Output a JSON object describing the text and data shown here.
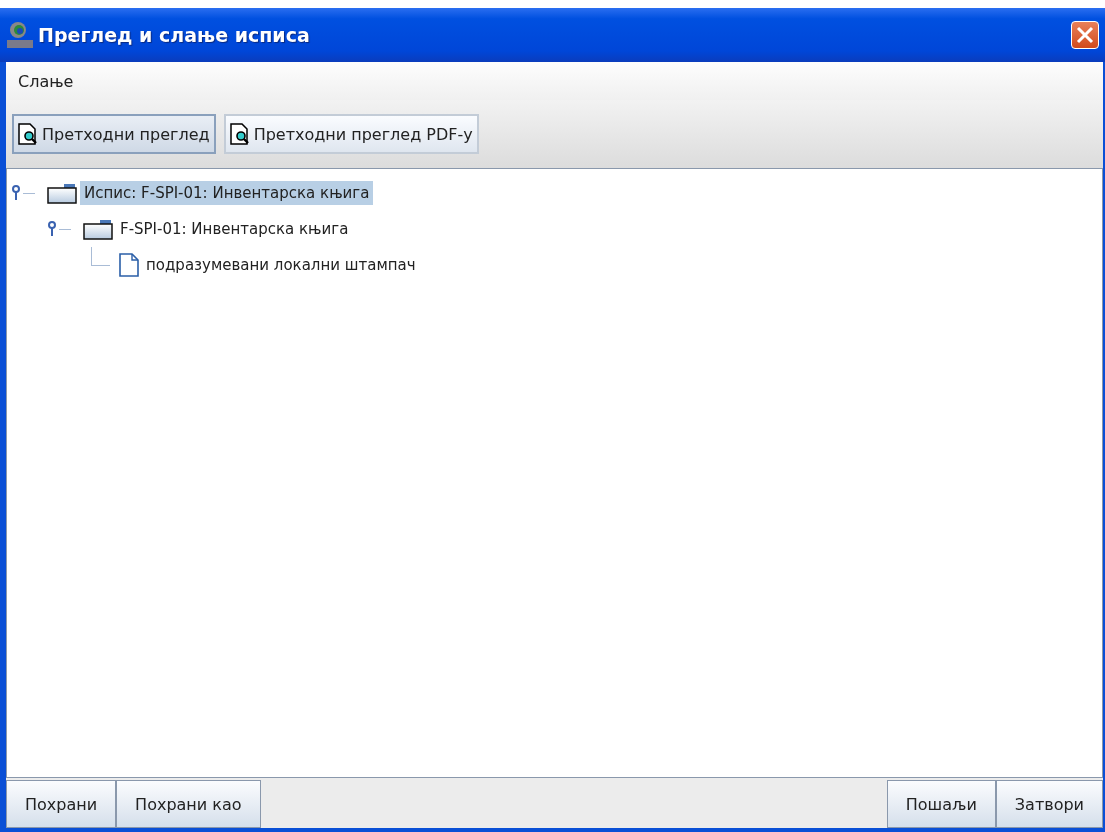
{
  "window": {
    "title": "Преглед и слање исписа"
  },
  "menu": [
    "Слање"
  ],
  "toolbar": [
    {
      "label": "Претходни преглед",
      "selected": true
    },
    {
      "label": "Претходни преглед PDF-у",
      "selected": false
    }
  ],
  "tree": [
    {
      "label": "Испис: F-SPI-01: Инвентарска књига",
      "kind": "folder",
      "selected": true,
      "expanded": true,
      "children": [
        {
          "label": "F-SPI-01: Инвентарска књига",
          "kind": "folder",
          "selected": false,
          "expanded": true,
          "children": [
            {
              "label": "подразумевани локални штампач",
              "kind": "file",
              "selected": false
            }
          ]
        }
      ]
    }
  ],
  "buttons_left": [
    "Похрани",
    "Похрани као"
  ],
  "buttons_right": [
    "Пошаљи",
    "Затвори"
  ]
}
